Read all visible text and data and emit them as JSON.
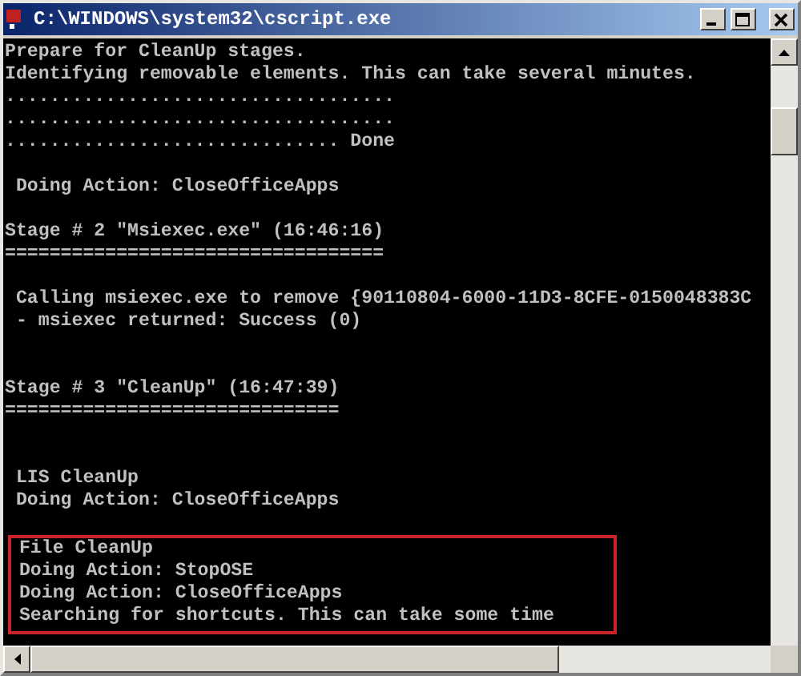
{
  "window": {
    "title": "C:\\WINDOWS\\system32\\cscript.exe"
  },
  "console": {
    "lines": [
      {
        "kind": "text",
        "text": "Prepare for CleanUp stages."
      },
      {
        "kind": "text",
        "text": "Identifying removable elements. This can take several minutes."
      },
      {
        "kind": "text",
        "text": "..................................."
      },
      {
        "kind": "text",
        "text": "..................................."
      },
      {
        "kind": "text",
        "text": ".............................. Done"
      },
      {
        "kind": "blank"
      },
      {
        "kind": "text",
        "text": " Doing Action: CloseOfficeApps"
      },
      {
        "kind": "blank"
      },
      {
        "kind": "text",
        "text": "Stage # 2 \"Msiexec.exe\" (16:46:16)"
      },
      {
        "kind": "text",
        "text": "=================================="
      },
      {
        "kind": "blank"
      },
      {
        "kind": "text",
        "text": " Calling msiexec.exe to remove {90110804-6000-11D3-8CFE-0150048383C"
      },
      {
        "kind": "text",
        "text": " - msiexec returned: Success (0)"
      },
      {
        "kind": "blank"
      },
      {
        "kind": "blank"
      },
      {
        "kind": "text",
        "text": "Stage # 3 \"CleanUp\" (16:47:39)"
      },
      {
        "kind": "text",
        "text": "=============================="
      },
      {
        "kind": "blank"
      },
      {
        "kind": "blank"
      },
      {
        "kind": "text",
        "text": " LIS CleanUp"
      },
      {
        "kind": "text",
        "text": " Doing Action: CloseOfficeApps"
      },
      {
        "kind": "blank"
      }
    ],
    "marked_block": {
      "lines": [
        {
          "kind": "text",
          "text": " File CleanUp"
        },
        {
          "kind": "text",
          "text": " Doing Action: StopOSE"
        },
        {
          "kind": "text",
          "text": " Doing Action: CloseOfficeApps"
        },
        {
          "kind": "text",
          "text": " Searching for shortcuts. This can take some time"
        }
      ]
    }
  }
}
